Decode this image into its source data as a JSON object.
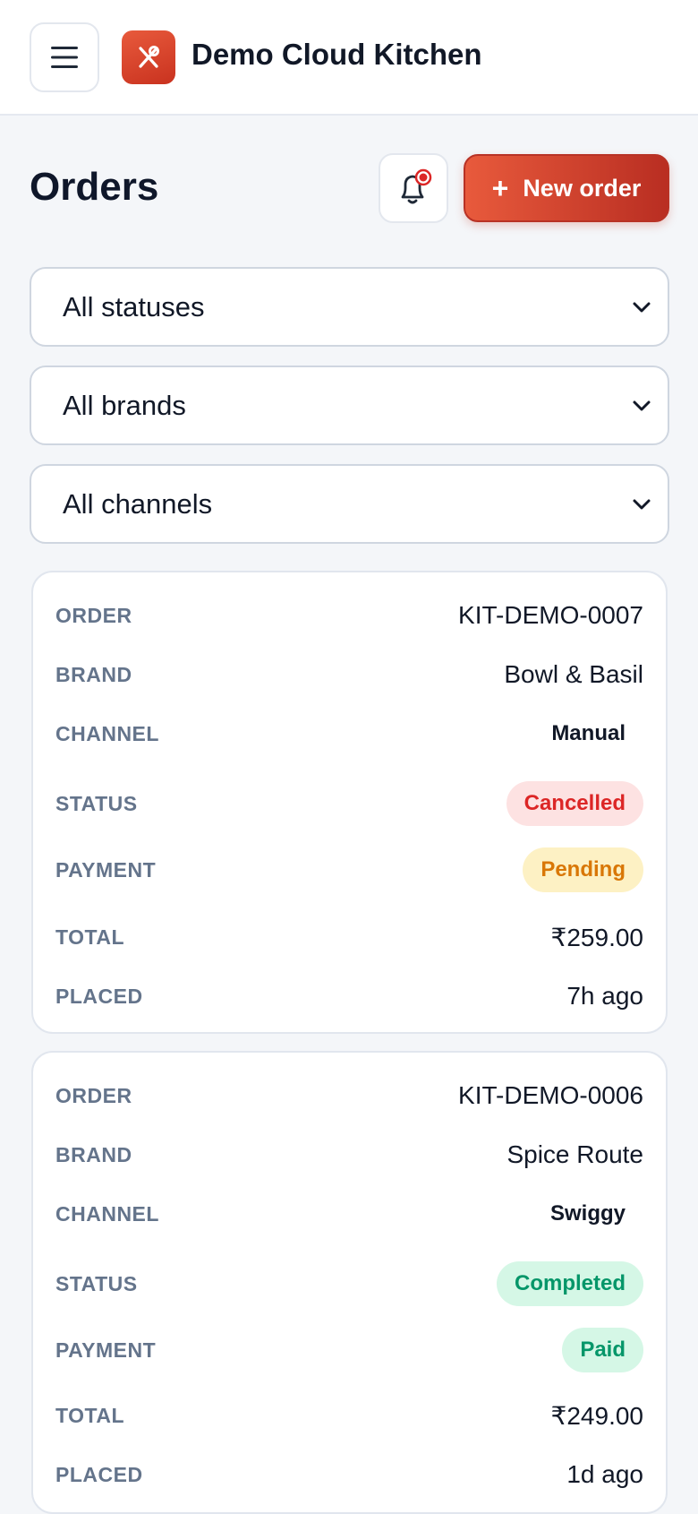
{
  "header": {
    "app_title": "Demo Cloud Kitchen"
  },
  "page": {
    "title": "Orders",
    "new_order_label": "New order"
  },
  "filters": [
    {
      "value": "All statuses"
    },
    {
      "value": "All brands"
    },
    {
      "value": "All channels"
    }
  ],
  "labels": {
    "order": "ORDER",
    "brand": "BRAND",
    "channel": "CHANNEL",
    "status": "STATUS",
    "payment": "PAYMENT",
    "total": "TOTAL",
    "placed": "PLACED"
  },
  "orders": [
    {
      "order": "KIT-DEMO-0007",
      "brand": "Bowl & Basil",
      "channel": "Manual",
      "status": "Cancelled",
      "payment": "Pending",
      "total": "₹259.00",
      "placed": "7h ago"
    },
    {
      "order": "KIT-DEMO-0006",
      "brand": "Spice Route",
      "channel": "Swiggy",
      "status": "Completed",
      "payment": "Paid",
      "total": "₹249.00",
      "placed": "1d ago"
    }
  ],
  "colors": {
    "accent": "#e04a30",
    "cancelled_bg": "#fde2e2",
    "cancelled_fg": "#dc2626",
    "pending_bg": "#fdf1c4",
    "pending_fg": "#d97706",
    "completed_bg": "#d5f7e6",
    "completed_fg": "#059669"
  },
  "icons": {
    "menu": "hamburger-menu-icon",
    "logo": "utensils-icon",
    "bell": "bell-icon",
    "select_chevron": "chevron-down-icon",
    "new_order": "plus-icon"
  }
}
